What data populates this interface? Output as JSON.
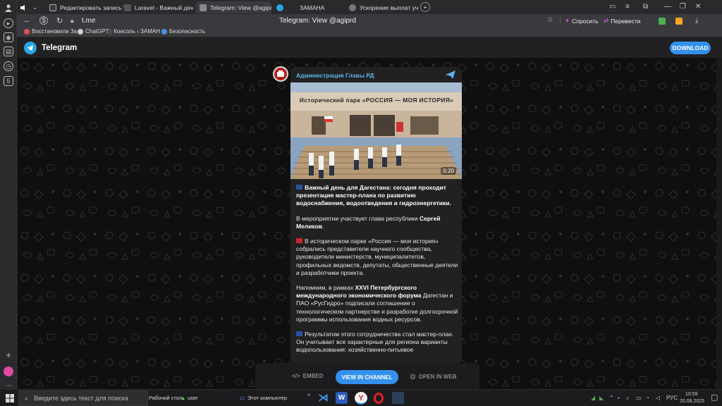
{
  "tabs": [
    {
      "title": "Редактировать запись \"В",
      "active": false
    },
    {
      "title": "Laravel - Важный день д",
      "active": false
    },
    {
      "title": "Telegram: View @agiprd",
      "active": true
    },
    {
      "title": "ЗАМАНА",
      "active": false
    },
    {
      "title": "Ускорение выплат участ",
      "active": false
    }
  ],
  "address": {
    "url": "t.me",
    "page_title": "Telegram: View @agiprd",
    "ask_label": "Спросить",
    "translate_label": "Перевести"
  },
  "bookmarks": [
    {
      "label": "Восстановили За",
      "color": "#e05050"
    },
    {
      "label": "ChatGPT",
      "color": "#cfcfcf"
    },
    {
      "label": "Консоль ‹ ЗАМАН",
      "color": "#555555"
    },
    {
      "label": "Безопасность",
      "color": "#4a8fe0"
    }
  ],
  "telegram": {
    "app_name": "Telegram",
    "download_label": "DOWNLOAD"
  },
  "post": {
    "channel_name": "Администрация Главы РД",
    "media_caption": "Исторический парк «РОССИЯ — МОЯ ИСТОРИЯ»",
    "duration": "0:20",
    "p1": "Важный день для Дагестана: сегодня проходит презентация мастер-плана по развитию водоснабжения, водоотведения и гидроэнергетики.",
    "p2_a": "В мероприятии участвует глава республики ",
    "p2_b": "Сергей Меликов",
    "p2_c": ".",
    "p3": "В историческом парке «Россия — моя история» собрались представители научного сообщества, руководители министерств, муниципалитетов, профильных ведомств, депутаты, общественные деятели и разработчики проекта.",
    "p4_a": "Напомним, в рамках ",
    "p4_b": "XXVI Петербургского международного экономического форума",
    "p4_c": " Дагестан и ПАО «РусГидро» подписали соглашение о технологическом партнерстве и разработке долгосрочной программы использования водных ресурсов.",
    "p5": "Результатом этого сотрудничества стал мастер-план. Он учитывает все характерные для региона варианты водопользования: хозяйственно-питьевое"
  },
  "actions": {
    "embed": "EMBED",
    "view_in_channel": "VIEW IN CHANNEL",
    "open_in_web": "OPEN IN WEB"
  },
  "taskbar": {
    "search_placeholder": "Введите здесь текст для поиска",
    "desktop_label": "Рабочий стол",
    "user_label": "user",
    "computer_label": "Этот компьютер",
    "lang": "РУС",
    "time": "10:59",
    "date": "20.08.2025"
  },
  "colors": {
    "accent": "#3390ec",
    "link": "#5ab3f0",
    "card": "#212121"
  }
}
